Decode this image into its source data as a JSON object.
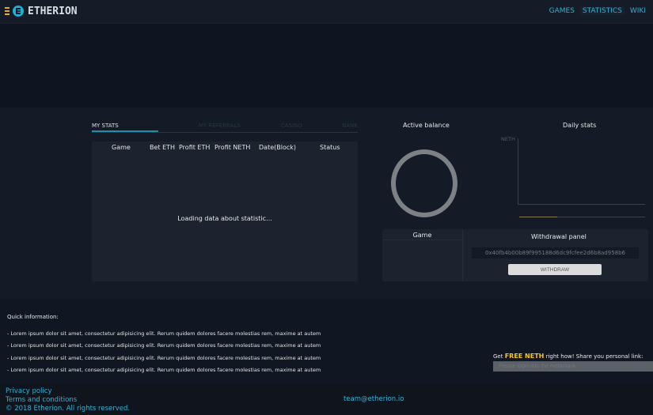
{
  "header": {
    "logo": "ETHERION",
    "nav": [
      "GAMES",
      "STATISTICS",
      "WIKI"
    ]
  },
  "stats": {
    "tabs": [
      "MY STATS",
      "MY REFERRALS",
      "CASINO",
      "BANK"
    ],
    "columns": [
      "Game",
      "Bet ETH",
      "Profit ETH",
      "Profit NETH",
      "Date(Block)",
      "Status"
    ],
    "loading": "Loading data about statistic..."
  },
  "balance": {
    "title": "Active balance"
  },
  "daily": {
    "title": "Daily stats",
    "ylabel": "NETH",
    "progress": 0.3
  },
  "withdraw": {
    "game_label": "Game",
    "title": "Withdrawal panel",
    "address": "0x40fb4b00b89f995188d6dc9fcfee2d6b8ad958b6",
    "button": "WITHDRAW"
  },
  "quick": {
    "title": "Quick information:",
    "items": [
      "- Lorem ipsum dolor sit amet, consectetur adipisicing elit. Rerum quidem dolores facere molestias rem, maxime at autem",
      "- Lorem ipsum dolor sit amet, consectetur adipisicing elit. Rerum quidem dolores facere molestias rem, maxime at autem",
      "- Lorem ipsum dolor sit amet, consectetur adipisicing elit. Rerum quidem dolores facere molestias rem, maxime at autem",
      "- Lorem ipsum dolor sit amet, consectetur adipisicing elit. Rerum quidem dolores facere molestias rem, maxime at autem"
    ]
  },
  "share": {
    "pre": "Get",
    "highlight": "FREE NETH",
    "post": "right how! Share you personal link:",
    "placeholder": "Please login into the metamask"
  },
  "footer": {
    "privacy": "Privacy policy",
    "terms": "Terms and conditions",
    "copyright": "© 2018 Etherion. All rights reserved.",
    "email": "team@etherion.io"
  }
}
